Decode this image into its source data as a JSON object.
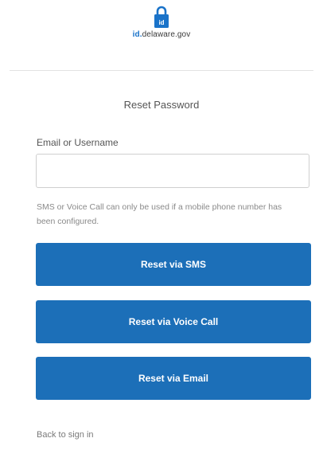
{
  "header": {
    "logo_id": "id.",
    "logo_domain": "delaware.gov",
    "logo_icon": "lock-icon"
  },
  "form": {
    "title": "Reset Password",
    "email_label": "Email or Username",
    "email_value": "",
    "email_placeholder": "",
    "hint": "SMS or Voice Call can only be used if a mobile phone number has been configured.",
    "buttons": {
      "sms": "Reset via SMS",
      "voice": "Reset via Voice Call",
      "email": "Reset via Email"
    },
    "back_link": "Back to sign in"
  },
  "colors": {
    "primary": "#1c6fb8",
    "logo_accent": "#1a73c9"
  }
}
